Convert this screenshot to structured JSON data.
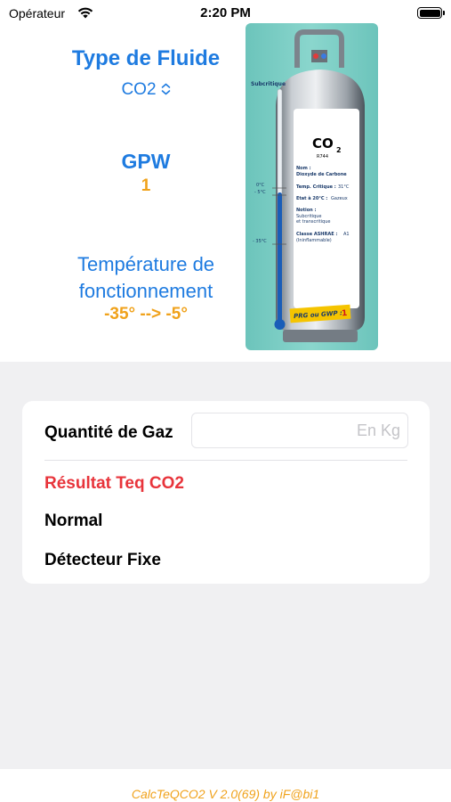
{
  "status_bar": {
    "carrier": "Opérateur",
    "time": "2:20 PM",
    "wifi_icon": "wifi-icon",
    "battery_icon": "battery-icon"
  },
  "fluid": {
    "title": "Type de Fluide",
    "selected": "CO2",
    "chevron_icon": "chevron-up-down-icon"
  },
  "gpw": {
    "title": "GPW",
    "value": "1"
  },
  "temperature": {
    "title_line1": "Température de",
    "title_line2": "fonctionnement",
    "range": "-35° --> -5°"
  },
  "cylinder": {
    "formula": "CO",
    "formula_sub": "2",
    "code": "R744",
    "subcritique": "Subcritique",
    "nom_label": "Nom :",
    "nom_value": "Dioxyde de Carbone",
    "critique_label": "Temp. Critique :",
    "critique_value": "31°C",
    "etat_label": "Etat à 20°C :",
    "etat_value": "Gazeux",
    "notion_label": "Notion :",
    "notion_value1": "Subcritique",
    "notion_value2": "et transcritique",
    "ashrae_label": "Classe ASHRAE :",
    "ashrae_value": "A1",
    "ashrae_note": "(Ininflammable)",
    "prg_label": "PRG ou GWP :",
    "prg_value": "1",
    "tick_0": "0°C",
    "tick_m5": "- 5°C",
    "tick_m35": "- 35°C",
    "colors": {
      "panel": "#7fcfc6",
      "tag": "#f5c400",
      "mercury": "#1a5db8"
    }
  },
  "form": {
    "quantity_label": "Quantité de Gaz",
    "quantity_value": "",
    "quantity_placeholder": "En Kg",
    "result_title": "Résultat Teq CO2",
    "result_normal": "Normal",
    "result_detector": "Détecteur Fixe"
  },
  "footer": {
    "version": "CalcTeQCO2 V 2.0(69) by iF@bi1"
  },
  "colors": {
    "accent_blue": "#1e7be0",
    "accent_orange": "#f0a21b",
    "result_red": "#e8343b",
    "background": "#f0f0f2"
  }
}
